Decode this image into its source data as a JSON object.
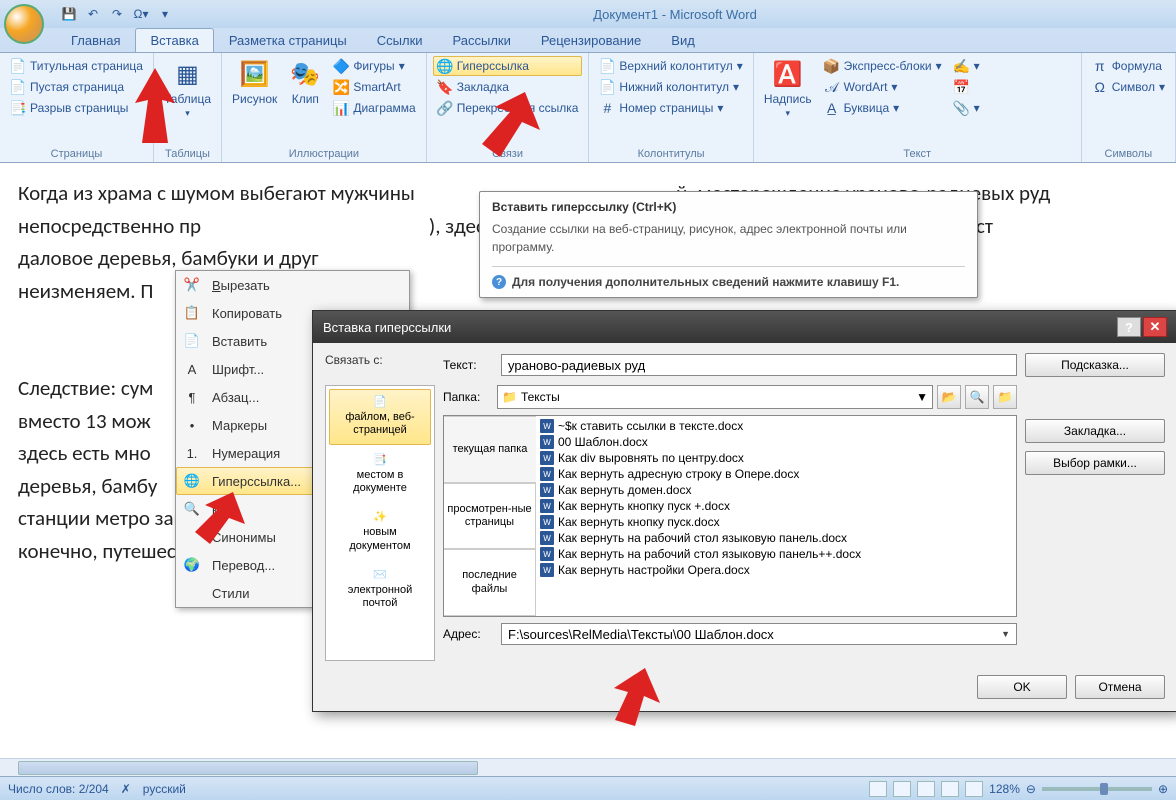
{
  "title": "Документ1 - Microsoft Word",
  "tabs": [
    "Главная",
    "Вставка",
    "Разметка страницы",
    "Ссылки",
    "Рассылки",
    "Рецензирование",
    "Вид"
  ],
  "active_tab": 1,
  "ribbon": {
    "pages": {
      "label": "Страницы",
      "items": [
        "Титульная страница",
        "Пустая страница",
        "Разрыв страницы"
      ]
    },
    "tables": {
      "label": "Таблицы",
      "btn": "Таблица"
    },
    "illus": {
      "label": "Иллюстрации",
      "pic": "Рисунок",
      "clip": "Клип",
      "items": [
        "Фигуры",
        "SmartArt",
        "Диаграмма"
      ]
    },
    "links": {
      "label": "Связи",
      "hyper": "Гиперссылка",
      "bookmark": "Закладка",
      "cross": "Перекрестная ссылка"
    },
    "hf": {
      "label": "Колонтитулы",
      "items": [
        "Верхний колонтитул",
        "Нижний колонтитул",
        "Номер страницы"
      ]
    },
    "text": {
      "label": "Текст",
      "box": "Надпись",
      "items": [
        "Экспресс-блоки",
        "WordArt",
        "Буквица"
      ]
    },
    "symbols": {
      "label": "Символы",
      "items": [
        "Формула",
        "Символ"
      ]
    }
  },
  "tooltip": {
    "title": "Вставить гиперссылку (Ctrl+K)",
    "desc": "Создание ссылки на веб-страницу, рисунок, адрес электронной почты или программу.",
    "help": "Для получения дополнительных сведений нажмите клавишу F1."
  },
  "doc_text": "Когда из храма с шумом выбегают мужчины                                                       й, месторождение ураново-радиевых руд непосредственно пр                                                ), здесь есть много ценных пород д                                        езност                                                                       даловое деревья, бамбуки и друг                                                                                                                                                               неизменяем. П\n\n\nСледствие: сум\nвместо 13 мож\nздесь есть мно\nдеревья, бамбу\nстанции метро закрыты, те\nконечно, путешествие по ре",
  "ctx": {
    "cut": "Вырезать",
    "copy": "Копировать",
    "paste": "Вставить",
    "font": "Шрифт...",
    "para": "Абзац...",
    "bullets": "Маркеры",
    "numbering": "Нумерация",
    "hyper": "Гиперссылка...",
    "lookup": "к...",
    "synonyms": "Синонимы",
    "translate": "Перевод...",
    "styles": "Стили"
  },
  "dialog": {
    "title": "Вставка гиперссылки",
    "link_to_label": "Связать с:",
    "text_label": "Текст:",
    "text_value": "ураново-радиевых руд",
    "tip_btn": "Подсказка...",
    "folder_label": "Папка:",
    "folder_value": "Тексты",
    "link_to": [
      "файлом, веб-страницей",
      "местом в документе",
      "новым документом",
      "электронной почтой"
    ],
    "btabs": [
      "текущая папка",
      "просмотрен-ные страницы",
      "последние файлы"
    ],
    "files": [
      "~$к ставить ссылки в тексте.docx",
      "00 Шаблон.docx",
      "Как div выровнять по центру.docx",
      "Как вернуть адресную строку в Опере.docx",
      "Как вернуть домен.docx",
      "Как вернуть кнопку пуск +.docx",
      "Как вернуть кнопку пуск.docx",
      "Как вернуть на рабочий стол языковую панель.docx",
      "Как вернуть на рабочий стол языковую панель++.docx",
      "Как вернуть настройки Opera.docx"
    ],
    "addr_label": "Адрес:",
    "addr_value": "F:\\sources\\RelMedia\\Тексты\\00 Шаблон.docx",
    "bookmark_btn": "Закладка...",
    "frame_btn": "Выбор рамки...",
    "ok": "OK",
    "cancel": "Отмена"
  },
  "status": {
    "words": "Число слов: 2/204",
    "lang": "русский",
    "zoom": "128%"
  }
}
